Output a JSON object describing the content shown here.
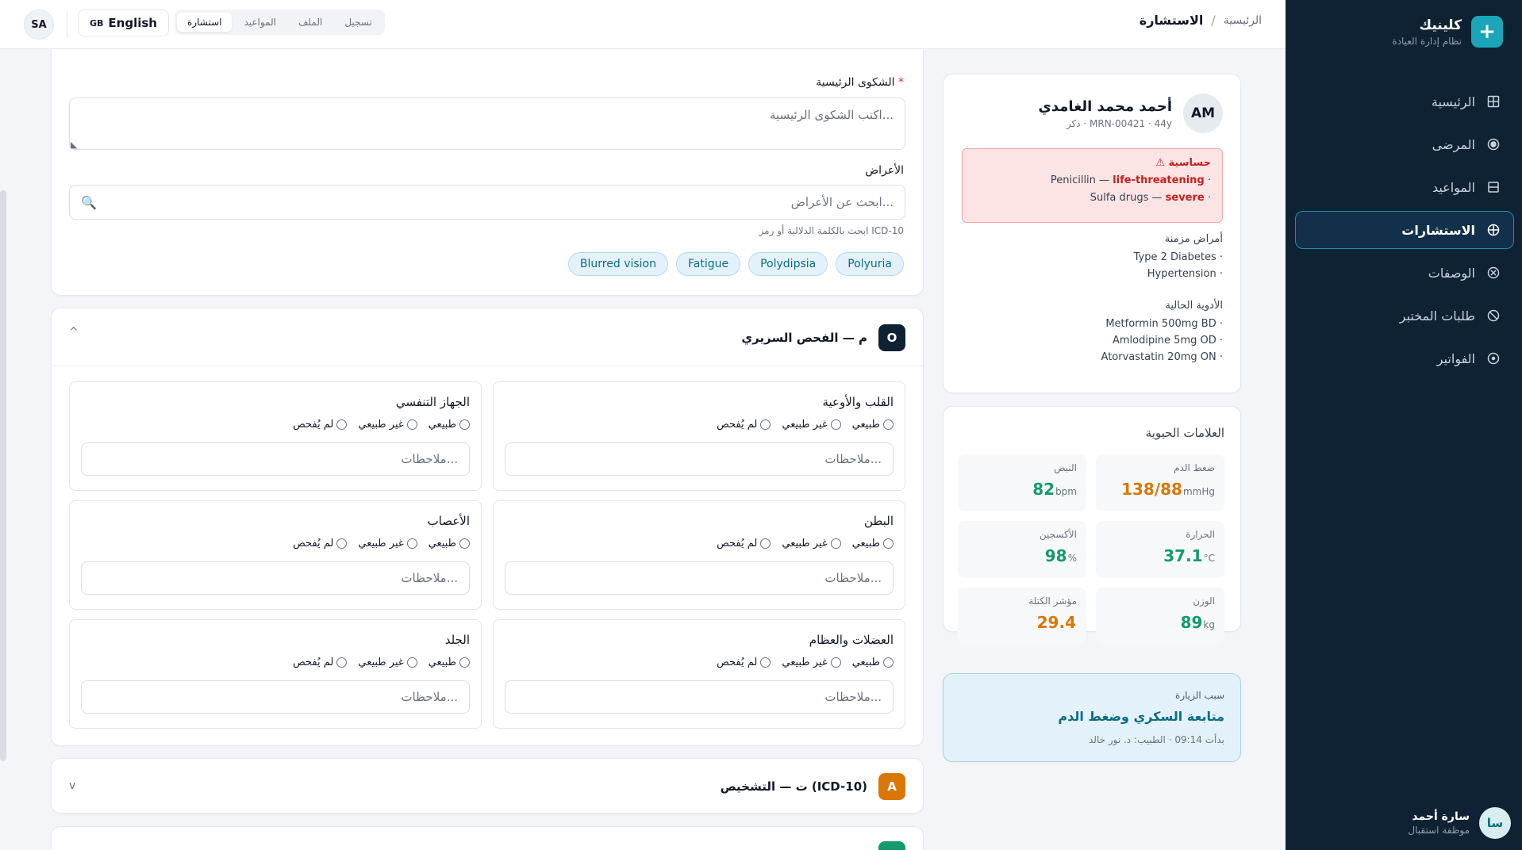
{
  "brand": {
    "logo": "+",
    "title": "كلينيك",
    "subtitle": "نظام إدارة العيادة"
  },
  "nav": [
    {
      "label": "الرئيسية",
      "icon": "grid-icon"
    },
    {
      "label": "المرضى",
      "icon": "patients-icon"
    },
    {
      "label": "المواعيد",
      "icon": "calendar-icon"
    },
    {
      "label": "الاستشارات",
      "icon": "consult-icon",
      "active": true
    },
    {
      "label": "الوصفات",
      "icon": "prescription-icon"
    },
    {
      "label": "طلبات المختبر",
      "icon": "lab-icon"
    },
    {
      "label": "الفواتير",
      "icon": "billing-icon"
    }
  ],
  "user": {
    "initials": "سا",
    "name": "سارة أحمد",
    "role": "موظفة استقبال"
  },
  "topbar": {
    "breadcrumb_home": "الرئيسية",
    "breadcrumb_sep": "/",
    "breadcrumb_current": "الاستشارة",
    "user_badge": "SA",
    "lang_flag": "GB",
    "lang_label": "English",
    "tabs": [
      "تسجيل",
      "الملف",
      "المواعيد",
      "استشارة"
    ],
    "active_tab": "استشارة"
  },
  "patient": {
    "initials": "AM",
    "name": "أحمد محمد الغامدي",
    "meta": "ذكر · MRN-00421 · 44y",
    "allergy_title": "حساسية",
    "allergies": [
      {
        "drug": "Penicillin",
        "sep": " — ",
        "severity": "life-threatening"
      },
      {
        "drug": "Sulfa drugs",
        "sep": " — ",
        "severity": "severe"
      }
    ],
    "chronic_title": "أمراض مزمنة",
    "chronic": [
      "Type 2 Diabetes",
      "Hypertension"
    ],
    "meds_title": "الأدوية الحالية",
    "meds": [
      "Metformin 500mg BD",
      "Amlodipine 5mg OD",
      "Atorvastatin 20mg ON"
    ]
  },
  "vitals": {
    "title": "العلامات الحيوية",
    "items": [
      {
        "label": "ضغط الدم",
        "value": "138/88",
        "unit": "mmHg",
        "color": "#d97706"
      },
      {
        "label": "النبض",
        "value": "82",
        "unit": "bpm",
        "color": "#159a6b"
      },
      {
        "label": "الحرارة",
        "value": "37.1",
        "unit": "°C",
        "color": "#159a6b"
      },
      {
        "label": "الأكسجين",
        "value": "98",
        "unit": "%",
        "color": "#159a6b"
      },
      {
        "label": "الوزن",
        "value": "89",
        "unit": "kg",
        "color": "#159a6b"
      },
      {
        "label": "مؤشر الكتلة",
        "value": "29.4",
        "unit": "",
        "color": "#d97706"
      }
    ]
  },
  "visit": {
    "label": "سبب الزيارة",
    "reason": "متابعة السكري وضغط الدم",
    "meta": "بدأت 09:14 · الطبيب: د. نور خالد"
  },
  "complaint": {
    "label": "الشكوى الرئيسية",
    "required_mark": "*",
    "placeholder": "اكتب الشكوى الرئيسية..."
  },
  "symptoms": {
    "label": "الأعراض",
    "placeholder": "ابحث عن الأعراض...",
    "hint": "ابحث بالكلمة الدلالية أو رمز ICD-10",
    "chips": [
      "Polyuria",
      "Polydipsia",
      "Fatigue",
      "Blurred vision"
    ]
  },
  "exam": {
    "letter": "O",
    "title": "م — الفحص السريري",
    "chevron": "^",
    "options": [
      "طبيعي",
      "غير طبيعي",
      "لم يُفحص"
    ],
    "notes_placeholder": "ملاحظات...",
    "systems": [
      "القلب والأوعية",
      "الجهاز التنفسي",
      "البطن",
      "الأعصاب",
      "العضلات والعظام",
      "الجلد"
    ]
  },
  "diagnosis": {
    "letter": "A",
    "title": "ت — التشخيص (ICD-10)",
    "chevron": "v"
  }
}
